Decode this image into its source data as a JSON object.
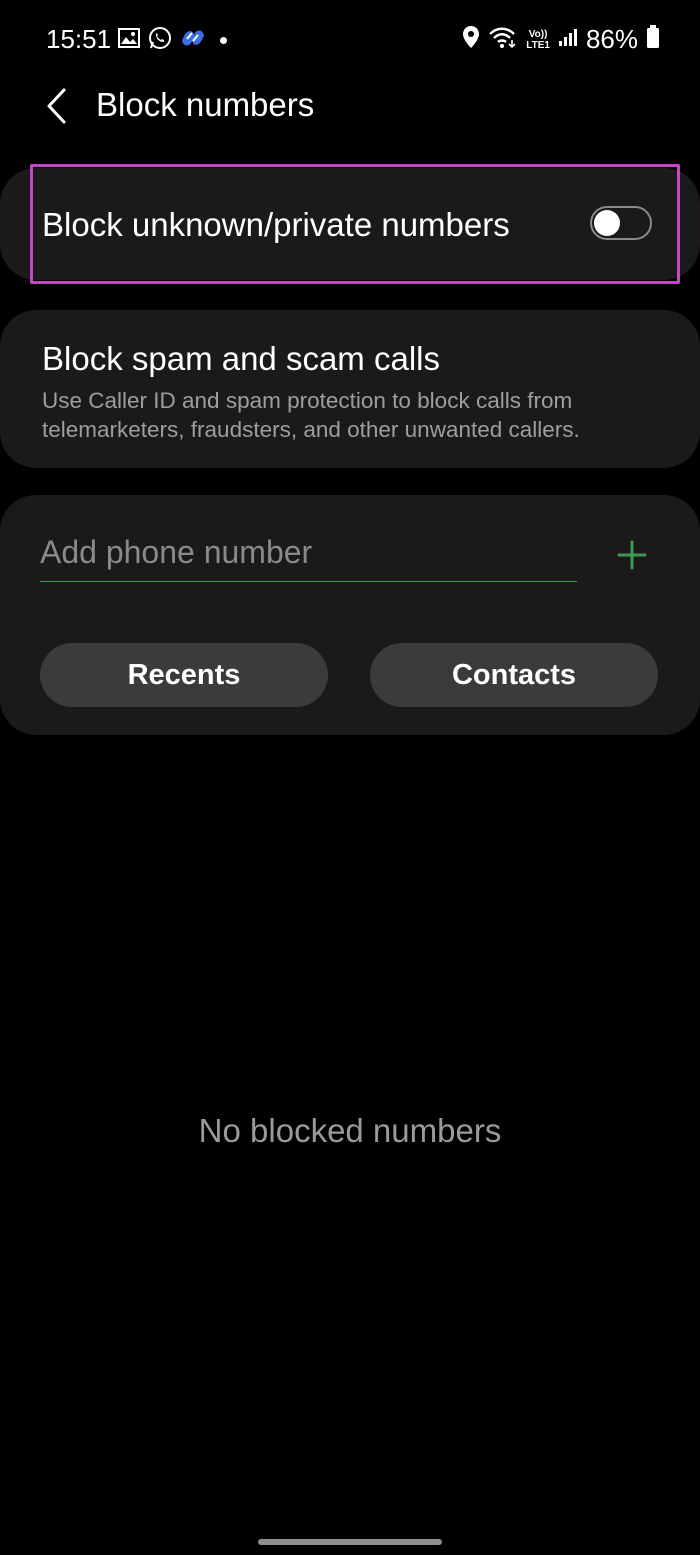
{
  "status_bar": {
    "time": "15:51",
    "battery": "86%",
    "left_icons": [
      "gallery-icon",
      "whatsapp-icon",
      "app-icon",
      "dot"
    ],
    "right_icons": [
      "location-icon",
      "wifi-icon",
      "volte-icon",
      "signal-icon",
      "battery-icon"
    ],
    "volte_top": "Vo))",
    "volte_bottom": "LTE1"
  },
  "header": {
    "title": "Block numbers"
  },
  "unknown_numbers": {
    "label": "Block unknown/private numbers",
    "toggle_on": false
  },
  "spam_calls": {
    "title": "Block spam and scam calls",
    "description": "Use Caller ID and spam protection to block calls from telemarketers, fraudsters, and other unwanted callers."
  },
  "add_number": {
    "placeholder": "Add phone number",
    "value": "",
    "recents_label": "Recents",
    "contacts_label": "Contacts"
  },
  "empty_state": "No blocked numbers",
  "colors": {
    "accent_green": "#3c9b4f",
    "highlight_magenta": "#c447c4",
    "card_bg": "#1a1a1a"
  }
}
